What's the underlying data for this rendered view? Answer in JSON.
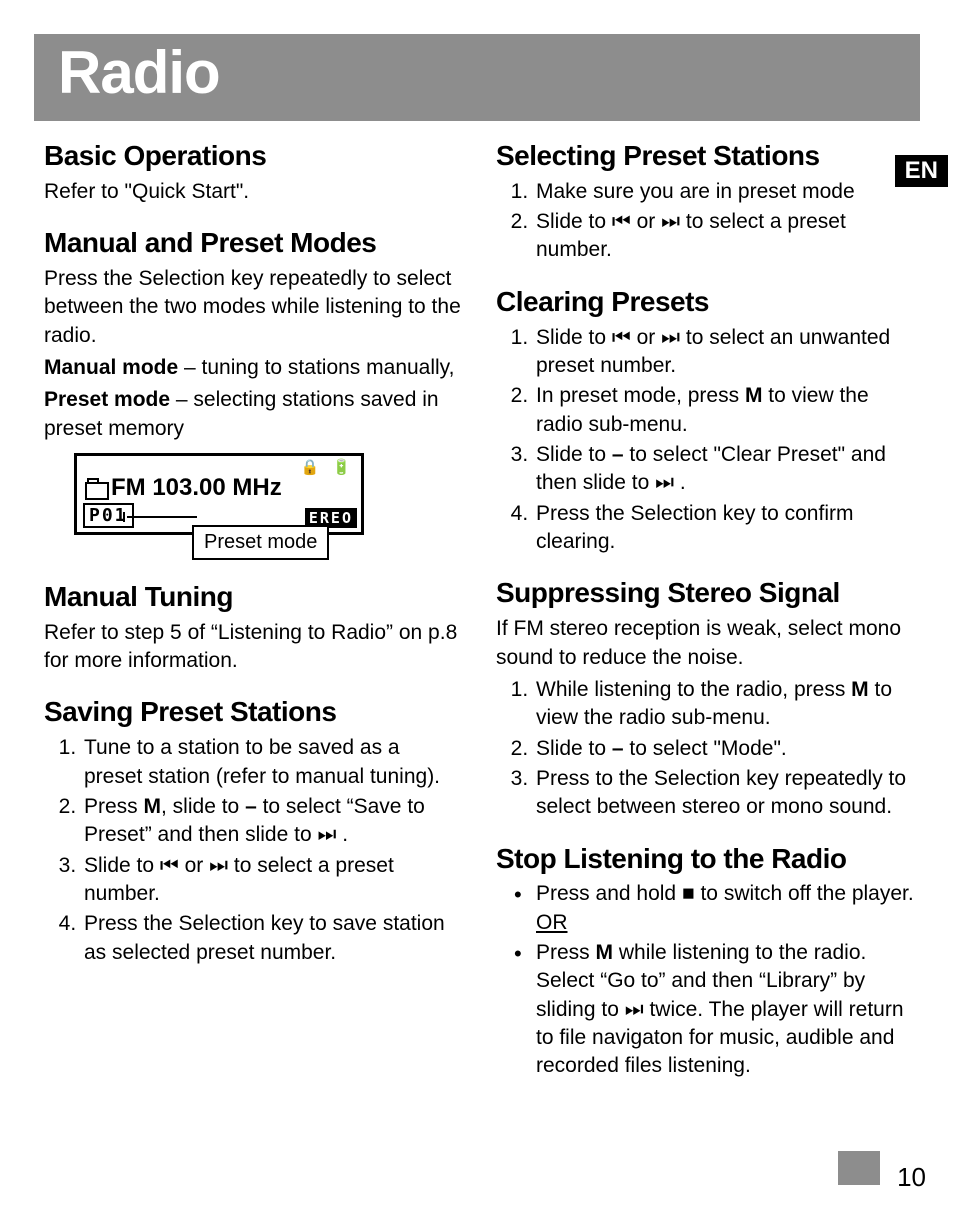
{
  "header": {
    "title": "Radio",
    "lang": "EN"
  },
  "left": {
    "basic": {
      "h": "Basic Operations",
      "p": "Refer to \"Quick Start\"."
    },
    "modes": {
      "h": "Manual and Preset Modes",
      "p1": "Press the Selection key repeatedly to select between the two modes while listening to the radio.",
      "manual_b": "Manual mode",
      "manual_rest": " – tuning to stations manually,",
      "preset_b": "Preset mode",
      "preset_rest": " – selecting stations saved in preset memory"
    },
    "lcd": {
      "freq": "FM 103.00 MHz",
      "preset": "P01",
      "stereo": "EREO",
      "callout": "Preset mode"
    },
    "tuning": {
      "h": "Manual Tuning",
      "p": "Refer to step 5 of “Listening to Radio” on p.8 for more information."
    },
    "saving": {
      "h": "Saving Preset Stations",
      "s1": "Tune to a station to be saved as a preset station (refer to manual tuning).",
      "s2a": "Press ",
      "s2b": "M",
      "s2c": ", slide to ",
      "s2d": "–",
      "s2e": " to select “Save to Preset” and then slide to ",
      "s2f": " .",
      "s3a": "Slide to ",
      "s3b": " or ",
      "s3c": " to select a preset number.",
      "s4": "Press the Selection key to save station as selected preset number."
    }
  },
  "right": {
    "select": {
      "h": "Selecting Preset Stations",
      "s1": "Make sure you are in preset mode",
      "s2a": "Slide to ",
      "s2b": " or ",
      "s2c": " to select a preset number."
    },
    "clear": {
      "h": "Clearing Presets",
      "s1a": "Slide to ",
      "s1b": " or ",
      "s1c": " to select an unwanted preset number.",
      "s2a": "In preset mode, press ",
      "s2b": "M",
      "s2c": " to view the radio sub-menu.",
      "s3a": "Slide to ",
      "s3b": "–",
      "s3c": " to select \"Clear Preset\" and then slide to ",
      "s3d": " .",
      "s4": "Press the Selection key to confirm clearing."
    },
    "stereo": {
      "h": "Suppressing Stereo Signal",
      "p": "If FM stereo reception is weak, select mono sound to reduce the noise.",
      "s1a": "While listening to the radio, press ",
      "s1b": "M",
      "s1c": " to view the radio sub-menu.",
      "s2a": "Slide to ",
      "s2b": "–",
      "s2c": " to select \"Mode\".",
      "s3": "Press to the Selection key repeatedly to select between stereo or mono sound."
    },
    "stop": {
      "h": "Stop Listening to the Radio",
      "b1a": "Press and hold ",
      "b1b": " to switch off the player. ",
      "b1c": "OR",
      "b2a": "Press ",
      "b2b": "M",
      "b2c": " while listening to the radio. Select “Go to” and then “Library” by sliding to ",
      "b2d": " twice. The player will return to file navigaton for music, audible and recorded files listening."
    }
  },
  "icons": {
    "prev": "⏮",
    "next": "⏭",
    "stop": "■"
  },
  "pagenum": "10"
}
